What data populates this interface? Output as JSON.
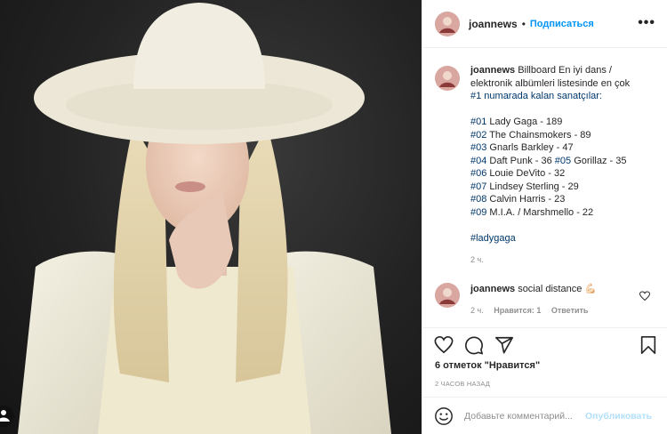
{
  "post": {
    "username": "joannews",
    "follow_label": "Подписаться",
    "header_dot": "•",
    "more_label": "•••",
    "image_alt_icon": "person-photo"
  },
  "caption": {
    "username": "joannews",
    "text_lines": [
      "Billboard En iyi dans /",
      "elektronik albümleri listesinde en çok",
      "#1 numarada kalan sanatçılar:"
    ],
    "ranking": [
      {
        "tag": "#01",
        "text": " Lady Gaga - 189"
      },
      {
        "tag": "#02",
        "text": " The Chainsmokers - 89"
      },
      {
        "tag": "#03",
        "text": " Gnarls Barkley - 47"
      },
      {
        "tag": "#04",
        "text": " Daft Punk - 36 ",
        "tag2": "#05",
        "text2": " Gorillaz - 35"
      },
      {
        "tag": "#06",
        "text": " Louie DeVito - 32"
      },
      {
        "tag": "#07",
        "text": " Lindsey Sterling - 29"
      },
      {
        "tag": "#08",
        "text": " Calvin Harris - 23"
      },
      {
        "tag": "#09",
        "text": " M.I.A. / Marshmello - 22"
      }
    ],
    "hashtag": "#ladygaga",
    "time": "2 ч."
  },
  "comment": {
    "username": "joannews",
    "text": "social distance",
    "emoji": "💪🏻",
    "time": "2 ч.",
    "likes": "Нравится: 1",
    "reply": "Ответить"
  },
  "actions": {
    "icons": [
      "heart-icon",
      "comment-icon",
      "share-icon",
      "bookmark-icon"
    ]
  },
  "likes_text": "6 отметок \"Нравится\"",
  "posted_time": "2 ЧАСОВ НАЗАД",
  "add_comment": {
    "placeholder": "Добавьте комментарий...",
    "publish_label": "Опубликовать"
  },
  "colors": {
    "accent": "#0095f6",
    "hashtag": "#00376b",
    "publish_disabled": "#b2dffc",
    "muted": "#8e8e8e"
  }
}
